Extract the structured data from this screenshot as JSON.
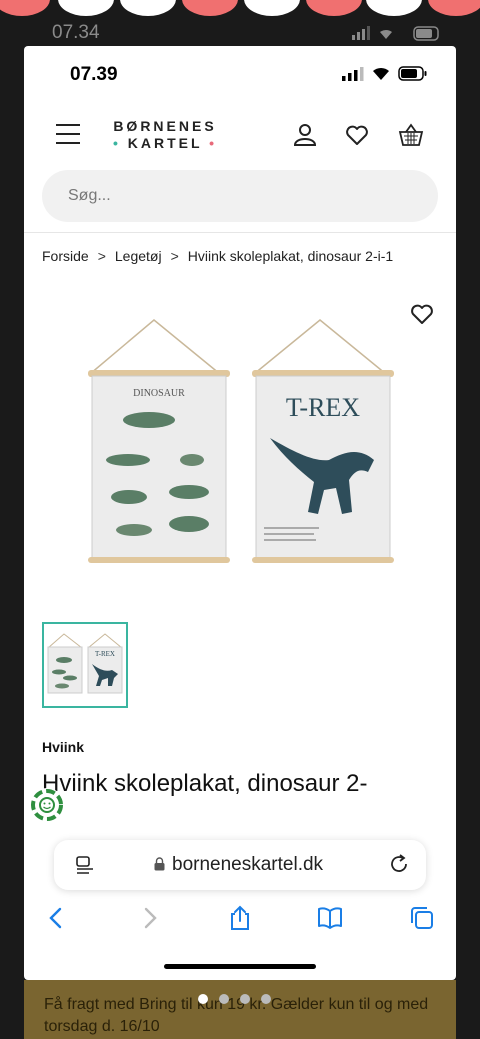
{
  "outer_status": {
    "time": "07.34"
  },
  "device_status": {
    "time": "07.39"
  },
  "header": {
    "logo_line1": "BØRNENES",
    "logo_line2": "KARTEL",
    "accent_color": "#3ab5a0",
    "accent_color_2": "#e86a7a"
  },
  "search": {
    "placeholder": "Søg..."
  },
  "breadcrumb": [
    {
      "label": "Forside"
    },
    {
      "label": "Legetøj"
    },
    {
      "label": "Hviink skoleplakat, dinosaur 2-i-1"
    }
  ],
  "product": {
    "brand": "Hviink",
    "title": "Hviink skoleplakat, dinosaur 2-",
    "poster_left_title": "DINOSAUR",
    "poster_right_title": "T-REX",
    "thumb_right_title": "T-REX"
  },
  "browser": {
    "url": "borneneskartel.dk"
  },
  "promo": {
    "text": "Få fragt med Bring til kun 19 kr. Gælder kun til og med torsdag d. 16/10"
  },
  "pager": {
    "count": 4,
    "active_index": 0
  }
}
